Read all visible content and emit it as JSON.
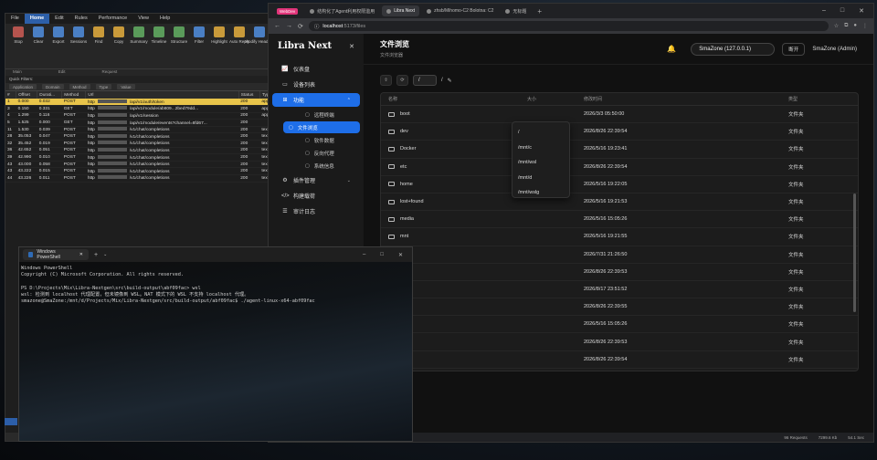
{
  "fiddler": {
    "menus": [
      "File",
      "Home",
      "Edit",
      "Rules",
      "Performance",
      "View",
      "Help"
    ],
    "ribbon": [
      "Stop",
      "Clear",
      "Export",
      "Sessions",
      "Find",
      "Copy",
      "Summary",
      "Timeline",
      "Structure",
      "Filter",
      "Highlight",
      "Auto Reply",
      "Modify Headers"
    ],
    "groups": [
      "Main",
      "Edit",
      "Request"
    ],
    "quick_filters": "Quick Filters:",
    "filters": [
      "Application",
      "Domain",
      "Method",
      "Type",
      "Value"
    ],
    "columns": [
      "#",
      "Offset",
      "Durati...",
      "Method",
      "Url",
      "Status",
      "Type"
    ],
    "rows": [
      {
        "id": "1",
        "offset": "0.000",
        "dur": "0.032",
        "method": "POST",
        "host": "http",
        "path": "/api/v1/auth/token",
        "status": "200",
        "type": "appl"
      },
      {
        "id": "3",
        "offset": "0.150",
        "dur": "0.331",
        "method": "GET",
        "host": "http",
        "path": "/api/v1/module/ab809...2bed79dd...",
        "status": "200",
        "type": "appl"
      },
      {
        "id": "4",
        "offset": "1.299",
        "dur": "0.116",
        "method": "POST",
        "host": "http",
        "path": "/api/v1/session",
        "status": "200",
        "type": "appl"
      },
      {
        "id": "5",
        "offset": "1.525",
        "dur": "0.000",
        "method": "GET",
        "host": "http",
        "path": "/api/v1/module/events?channel=8fd67...",
        "status": "200",
        "type": ""
      },
      {
        "id": "11",
        "offset": "1.530",
        "dur": "0.039",
        "method": "POST",
        "host": "http",
        "path": "/v1/chat/completions",
        "status": "200",
        "type": "text/"
      },
      {
        "id": "28",
        "offset": "35.053",
        "dur": "0.047",
        "method": "POST",
        "host": "http",
        "path": "/v1/chat/completions",
        "status": "200",
        "type": "text/"
      },
      {
        "id": "32",
        "offset": "35.452",
        "dur": "0.019",
        "method": "POST",
        "host": "http",
        "path": "/v1/chat/completions",
        "status": "200",
        "type": "text/"
      },
      {
        "id": "36",
        "offset": "42.652",
        "dur": "0.051",
        "method": "POST",
        "host": "http",
        "path": "/v1/chat/completions",
        "status": "200",
        "type": "text/"
      },
      {
        "id": "39",
        "offset": "42.990",
        "dur": "0.010",
        "method": "POST",
        "host": "http",
        "path": "/v1/chat/completions",
        "status": "200",
        "type": "text/"
      },
      {
        "id": "43",
        "offset": "43.000",
        "dur": "0.058",
        "method": "POST",
        "host": "http",
        "path": "/v1/chat/completions",
        "status": "200",
        "type": "text/"
      },
      {
        "id": "43",
        "offset": "43.222",
        "dur": "0.015",
        "method": "POST",
        "host": "http",
        "path": "/v1/chat/completions",
        "status": "200",
        "type": "text/"
      },
      {
        "id": "44",
        "offset": "43.226",
        "dur": "0.011",
        "method": "POST",
        "host": "http",
        "path": "/v1/chat/completions",
        "status": "200",
        "type": "text/"
      }
    ]
  },
  "browser": {
    "tabs": [
      {
        "label": "WebDev",
        "badge": true
      },
      {
        "label": "结构化了Agent利用权限滥用",
        "badge": false
      },
      {
        "label": "Libra Next",
        "badge": false
      },
      {
        "label": "zhsb/Mihomo-C2 Bolotna: C2",
        "badge": false
      },
      {
        "label": "无标题",
        "badge": false
      }
    ],
    "new_tab": "+",
    "url_host": "localhost",
    "url_port_path": ":5173/files",
    "status": {
      "requests": "96 Requests",
      "size": "7299.6 Kb",
      "time": "54.1 Sec"
    }
  },
  "app": {
    "brand": "Libra Next",
    "nav": [
      {
        "label": "仪表盘",
        "icon": "chart-icon"
      },
      {
        "label": "设备列表",
        "icon": "monitor-icon"
      },
      {
        "label": "功能",
        "icon": "grid-icon",
        "active": true
      }
    ],
    "subnav": [
      {
        "label": "远程终端",
        "active": false
      },
      {
        "label": "文件浏览",
        "active": true
      },
      {
        "label": "软件数据",
        "active": false
      },
      {
        "label": "反向代理",
        "active": false
      },
      {
        "label": "系统信息",
        "active": false
      }
    ],
    "nav2": [
      {
        "label": "插件管理"
      },
      {
        "label": "构建载荷"
      },
      {
        "label": "审计日志"
      }
    ],
    "page_title": "文件浏览",
    "page_subtitle": "文件浏览器",
    "server": "SmaZone (127.0.0.1)",
    "disconnect": "断开",
    "user": "SmaZone (Admin)",
    "path_value": "/",
    "crumb": "/",
    "cols": {
      "name": "名称",
      "size": "大小",
      "date": "修改时间",
      "type": "类型"
    },
    "files": [
      {
        "name": "boot",
        "date": "2026/3/3 05:50:00",
        "type": "文件夹"
      },
      {
        "name": "dev",
        "date": "2026/8/26 22:39:54",
        "type": "文件夹"
      },
      {
        "name": "Docker",
        "date": "2026/5/16 19:23:41",
        "type": "文件夹"
      },
      {
        "name": "etc",
        "date": "2026/8/26 22:39:54",
        "type": "文件夹"
      },
      {
        "name": "home",
        "date": "2026/5/16 19:22:05",
        "type": "文件夹"
      },
      {
        "name": "lost+found",
        "date": "2026/5/16 19:21:53",
        "type": "文件夹"
      },
      {
        "name": "media",
        "date": "2026/5/16 15:05:26",
        "type": "文件夹"
      },
      {
        "name": "mnt",
        "date": "2026/5/16 19:21:55",
        "type": "文件夹"
      },
      {
        "name": "",
        "date": "2026/7/31 21:26:50",
        "type": "文件夹"
      },
      {
        "name": "",
        "date": "2026/8/26 22:39:53",
        "type": "文件夹"
      },
      {
        "name": "",
        "date": "2026/8/17 23:51:52",
        "type": "文件夹"
      },
      {
        "name": "",
        "date": "2026/8/26 22:39:55",
        "type": "文件夹"
      },
      {
        "name": "",
        "date": "2026/5/16 15:05:26",
        "type": "文件夹"
      },
      {
        "name": "",
        "date": "2026/8/26 22:39:53",
        "type": "文件夹"
      },
      {
        "name": "",
        "date": "2026/8/26 22:39:54",
        "type": "文件夹"
      }
    ],
    "dropdown": [
      "/",
      "/mnt/c",
      "/mnt/wsl",
      "/mnt/d",
      "/mnt/wslg"
    ]
  },
  "terminal": {
    "tab": "Windows PowerShell",
    "lines": [
      "Windows PowerShell",
      "Copyright (C) Microsoft Corporation. All rights reserved.",
      "",
      "PS D:\\Projects\\Mix\\Libra-Nextgen\\src\\build-output\\abf09fac> wsl",
      "wsl: 检测到 localhost 代理配置，但未镜像到 WSL。NAT 模式下的 WSL 不支持 localhost 代理。",
      "smazone@SmaZone:/mnt/d/Projects/Mix/Libra-Nextgen/src/build-output/abf09fac$ ./agent-linux-x64-abf09fac"
    ]
  }
}
